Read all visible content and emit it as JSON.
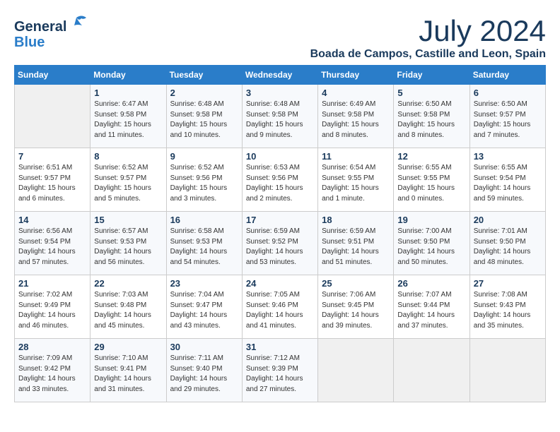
{
  "logo": {
    "line1": "General",
    "line2": "Blue"
  },
  "title": "July 2024",
  "location": "Boada de Campos, Castille and Leon, Spain",
  "headers": [
    "Sunday",
    "Monday",
    "Tuesday",
    "Wednesday",
    "Thursday",
    "Friday",
    "Saturday"
  ],
  "weeks": [
    [
      {
        "day": "",
        "info": ""
      },
      {
        "day": "1",
        "info": "Sunrise: 6:47 AM\nSunset: 9:58 PM\nDaylight: 15 hours\nand 11 minutes."
      },
      {
        "day": "2",
        "info": "Sunrise: 6:48 AM\nSunset: 9:58 PM\nDaylight: 15 hours\nand 10 minutes."
      },
      {
        "day": "3",
        "info": "Sunrise: 6:48 AM\nSunset: 9:58 PM\nDaylight: 15 hours\nand 9 minutes."
      },
      {
        "day": "4",
        "info": "Sunrise: 6:49 AM\nSunset: 9:58 PM\nDaylight: 15 hours\nand 8 minutes."
      },
      {
        "day": "5",
        "info": "Sunrise: 6:50 AM\nSunset: 9:58 PM\nDaylight: 15 hours\nand 8 minutes."
      },
      {
        "day": "6",
        "info": "Sunrise: 6:50 AM\nSunset: 9:57 PM\nDaylight: 15 hours\nand 7 minutes."
      }
    ],
    [
      {
        "day": "7",
        "info": "Sunrise: 6:51 AM\nSunset: 9:57 PM\nDaylight: 15 hours\nand 6 minutes."
      },
      {
        "day": "8",
        "info": "Sunrise: 6:52 AM\nSunset: 9:57 PM\nDaylight: 15 hours\nand 5 minutes."
      },
      {
        "day": "9",
        "info": "Sunrise: 6:52 AM\nSunset: 9:56 PM\nDaylight: 15 hours\nand 3 minutes."
      },
      {
        "day": "10",
        "info": "Sunrise: 6:53 AM\nSunset: 9:56 PM\nDaylight: 15 hours\nand 2 minutes."
      },
      {
        "day": "11",
        "info": "Sunrise: 6:54 AM\nSunset: 9:55 PM\nDaylight: 15 hours\nand 1 minute."
      },
      {
        "day": "12",
        "info": "Sunrise: 6:55 AM\nSunset: 9:55 PM\nDaylight: 15 hours\nand 0 minutes."
      },
      {
        "day": "13",
        "info": "Sunrise: 6:55 AM\nSunset: 9:54 PM\nDaylight: 14 hours\nand 59 minutes."
      }
    ],
    [
      {
        "day": "14",
        "info": "Sunrise: 6:56 AM\nSunset: 9:54 PM\nDaylight: 14 hours\nand 57 minutes."
      },
      {
        "day": "15",
        "info": "Sunrise: 6:57 AM\nSunset: 9:53 PM\nDaylight: 14 hours\nand 56 minutes."
      },
      {
        "day": "16",
        "info": "Sunrise: 6:58 AM\nSunset: 9:53 PM\nDaylight: 14 hours\nand 54 minutes."
      },
      {
        "day": "17",
        "info": "Sunrise: 6:59 AM\nSunset: 9:52 PM\nDaylight: 14 hours\nand 53 minutes."
      },
      {
        "day": "18",
        "info": "Sunrise: 6:59 AM\nSunset: 9:51 PM\nDaylight: 14 hours\nand 51 minutes."
      },
      {
        "day": "19",
        "info": "Sunrise: 7:00 AM\nSunset: 9:50 PM\nDaylight: 14 hours\nand 50 minutes."
      },
      {
        "day": "20",
        "info": "Sunrise: 7:01 AM\nSunset: 9:50 PM\nDaylight: 14 hours\nand 48 minutes."
      }
    ],
    [
      {
        "day": "21",
        "info": "Sunrise: 7:02 AM\nSunset: 9:49 PM\nDaylight: 14 hours\nand 46 minutes."
      },
      {
        "day": "22",
        "info": "Sunrise: 7:03 AM\nSunset: 9:48 PM\nDaylight: 14 hours\nand 45 minutes."
      },
      {
        "day": "23",
        "info": "Sunrise: 7:04 AM\nSunset: 9:47 PM\nDaylight: 14 hours\nand 43 minutes."
      },
      {
        "day": "24",
        "info": "Sunrise: 7:05 AM\nSunset: 9:46 PM\nDaylight: 14 hours\nand 41 minutes."
      },
      {
        "day": "25",
        "info": "Sunrise: 7:06 AM\nSunset: 9:45 PM\nDaylight: 14 hours\nand 39 minutes."
      },
      {
        "day": "26",
        "info": "Sunrise: 7:07 AM\nSunset: 9:44 PM\nDaylight: 14 hours\nand 37 minutes."
      },
      {
        "day": "27",
        "info": "Sunrise: 7:08 AM\nSunset: 9:43 PM\nDaylight: 14 hours\nand 35 minutes."
      }
    ],
    [
      {
        "day": "28",
        "info": "Sunrise: 7:09 AM\nSunset: 9:42 PM\nDaylight: 14 hours\nand 33 minutes."
      },
      {
        "day": "29",
        "info": "Sunrise: 7:10 AM\nSunset: 9:41 PM\nDaylight: 14 hours\nand 31 minutes."
      },
      {
        "day": "30",
        "info": "Sunrise: 7:11 AM\nSunset: 9:40 PM\nDaylight: 14 hours\nand 29 minutes."
      },
      {
        "day": "31",
        "info": "Sunrise: 7:12 AM\nSunset: 9:39 PM\nDaylight: 14 hours\nand 27 minutes."
      },
      {
        "day": "",
        "info": ""
      },
      {
        "day": "",
        "info": ""
      },
      {
        "day": "",
        "info": ""
      }
    ]
  ]
}
